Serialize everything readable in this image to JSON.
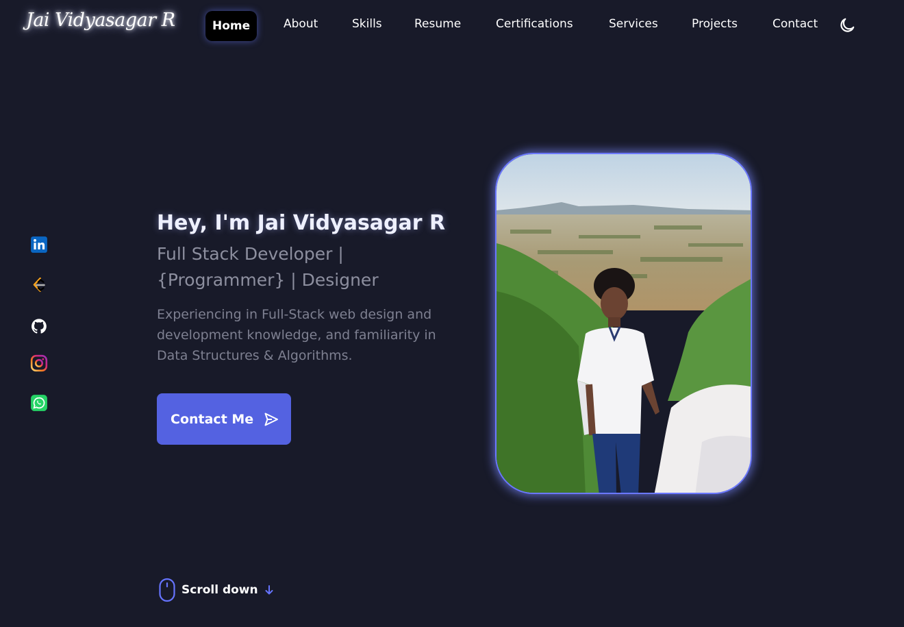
{
  "header": {
    "logo": "Jai Vidyasagar R",
    "nav": [
      {
        "label": "Home",
        "active": true
      },
      {
        "label": "About"
      },
      {
        "label": "Skills"
      },
      {
        "label": "Resume"
      },
      {
        "label": "Certifications"
      },
      {
        "label": "Services"
      },
      {
        "label": "Projects"
      },
      {
        "label": "Contact"
      }
    ],
    "theme_icon": "moon-icon"
  },
  "social": [
    {
      "name": "linkedin-icon"
    },
    {
      "name": "leetcode-icon"
    },
    {
      "name": "github-icon"
    },
    {
      "name": "instagram-icon"
    },
    {
      "name": "whatsapp-icon"
    }
  ],
  "hero": {
    "title": "Hey, I'm Jai Vidyasagar R",
    "subtitle": "Full Stack Developer | {Programmer} | Designer",
    "description": "Experiencing in Full-Stack web design and development knowledge, and familiarity in Data Structures & Algorithms.",
    "cta": "Contact Me"
  },
  "scroll": {
    "label": "Scroll down"
  },
  "colors": {
    "background": "#181a29",
    "accent": "#5462e1",
    "nav_active_bg": "#000000",
    "glow": "#6b78ff"
  }
}
